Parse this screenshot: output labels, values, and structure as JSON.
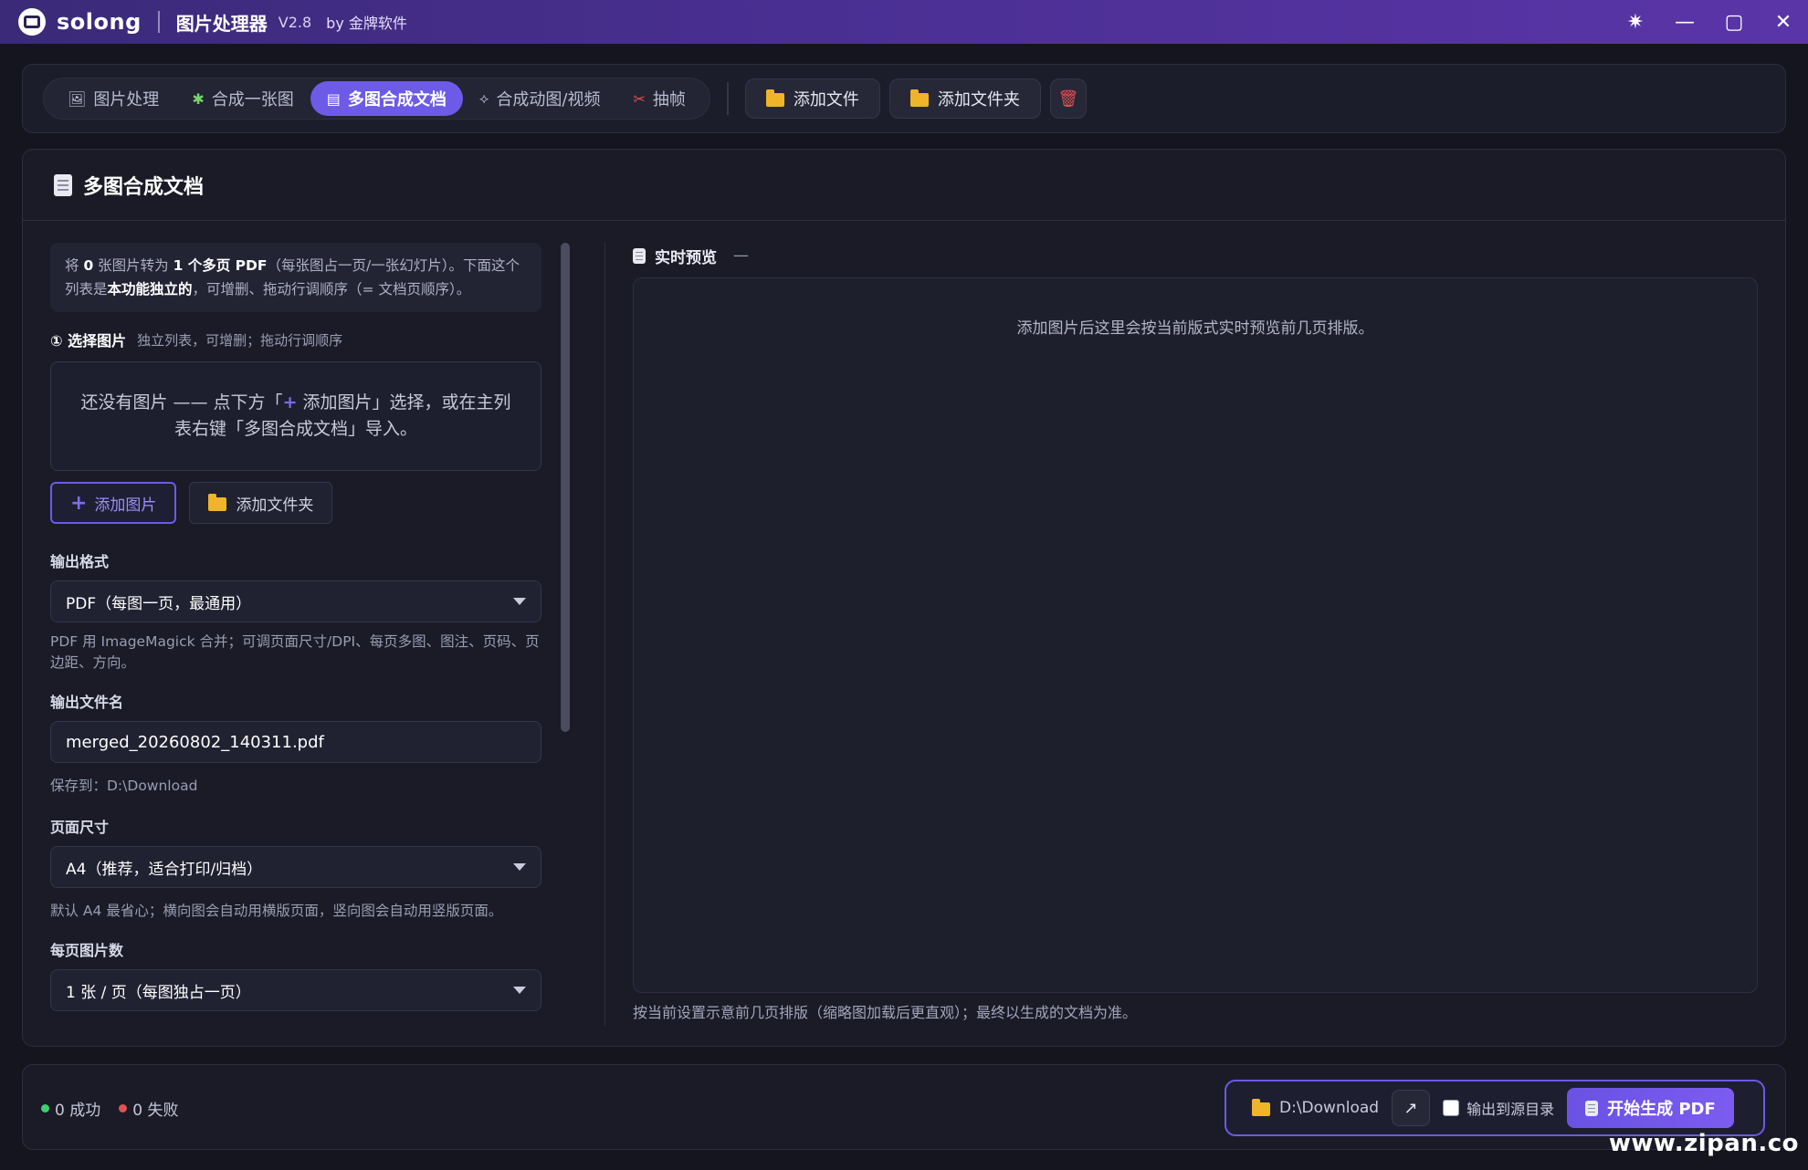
{
  "titlebar": {
    "brand": "solong",
    "app_name": "图片处理器",
    "version": "V2.8",
    "byline": "by 金牌软件",
    "controls": {
      "theme": "✷",
      "minimize": "—",
      "maximize": "▢",
      "close": "✕"
    }
  },
  "toolbar": {
    "tabs": [
      {
        "label": "图片处理",
        "icon": "image-icon",
        "glyph": "🖼"
      },
      {
        "label": "合成一张图",
        "icon": "puzzle-icon",
        "glyph": "✱"
      },
      {
        "label": "多图合成文档",
        "icon": "document-icon",
        "glyph": "▤",
        "active": true
      },
      {
        "label": "合成动图/视频",
        "icon": "link-icon",
        "glyph": "⟡"
      },
      {
        "label": "抽帧",
        "icon": "scissors-icon",
        "glyph": "✂"
      }
    ],
    "add_file": "添加文件",
    "add_folder": "添加文件夹",
    "trash_glyph": "🗑"
  },
  "panel": {
    "title": "多图合成文档",
    "info": {
      "p1": "将 ",
      "count": "0",
      "p2": " 张图片转为 ",
      "strong1": "1 个多页 PDF",
      "p3": "（每张图占一页/一张幻灯片）。下面这个列表是",
      "strong2": "本功能独立的",
      "p4": "，可增删、拖动行调顺序（= 文档页顺序）。"
    },
    "select_images": {
      "label": "① 选择图片",
      "hint": "独立列表，可增删；拖动行调顺序"
    },
    "empty": {
      "part1": "还没有图片 —— 点下方「",
      "plus": "+",
      "part2": " 添加图片」选择，或在主列表右键「多图合成文档」导入。"
    },
    "add_image_btn": "添加图片",
    "add_folder_btn": "添加文件夹",
    "output_format": {
      "label": "输出格式",
      "value": "PDF（每图一页，最通用）",
      "help": "PDF 用 ImageMagick 合并；可调页面尺寸/DPI、每页多图、图注、页码、页边距、方向。"
    },
    "output_name": {
      "label": "输出文件名",
      "value": "merged_20260802_140311.pdf",
      "save_to": "保存到：D:\\Download"
    },
    "page_size": {
      "label": "页面尺寸",
      "value": "A4（推荐，适合打印/归档）",
      "help": "默认 A4 最省心；横向图会自动用横版页面，竖向图会自动用竖版页面。"
    },
    "per_page": {
      "label": "每页图片数",
      "value": "1 张 / 页（每图独占一页）"
    }
  },
  "preview": {
    "title": "实时预览",
    "dash": "—",
    "message": "添加图片后这里会按当前版式实时预览前几页排版。",
    "footer": "按当前设置示意前几页排版（缩略图加载后更直观）；最终以生成的文档为准。"
  },
  "status": {
    "success": "0 成功",
    "fail": "0 失败",
    "output_dir": "D:\\Download",
    "open_glyph": "↗",
    "to_source_dir": "输出到源目录",
    "start_btn": "开始生成 PDF"
  },
  "watermark": "www.zipan.co",
  "colors": {
    "accent": "#6d5ae6",
    "success": "#3fcf6e",
    "fail": "#e05252",
    "folder": "#f0b429"
  }
}
